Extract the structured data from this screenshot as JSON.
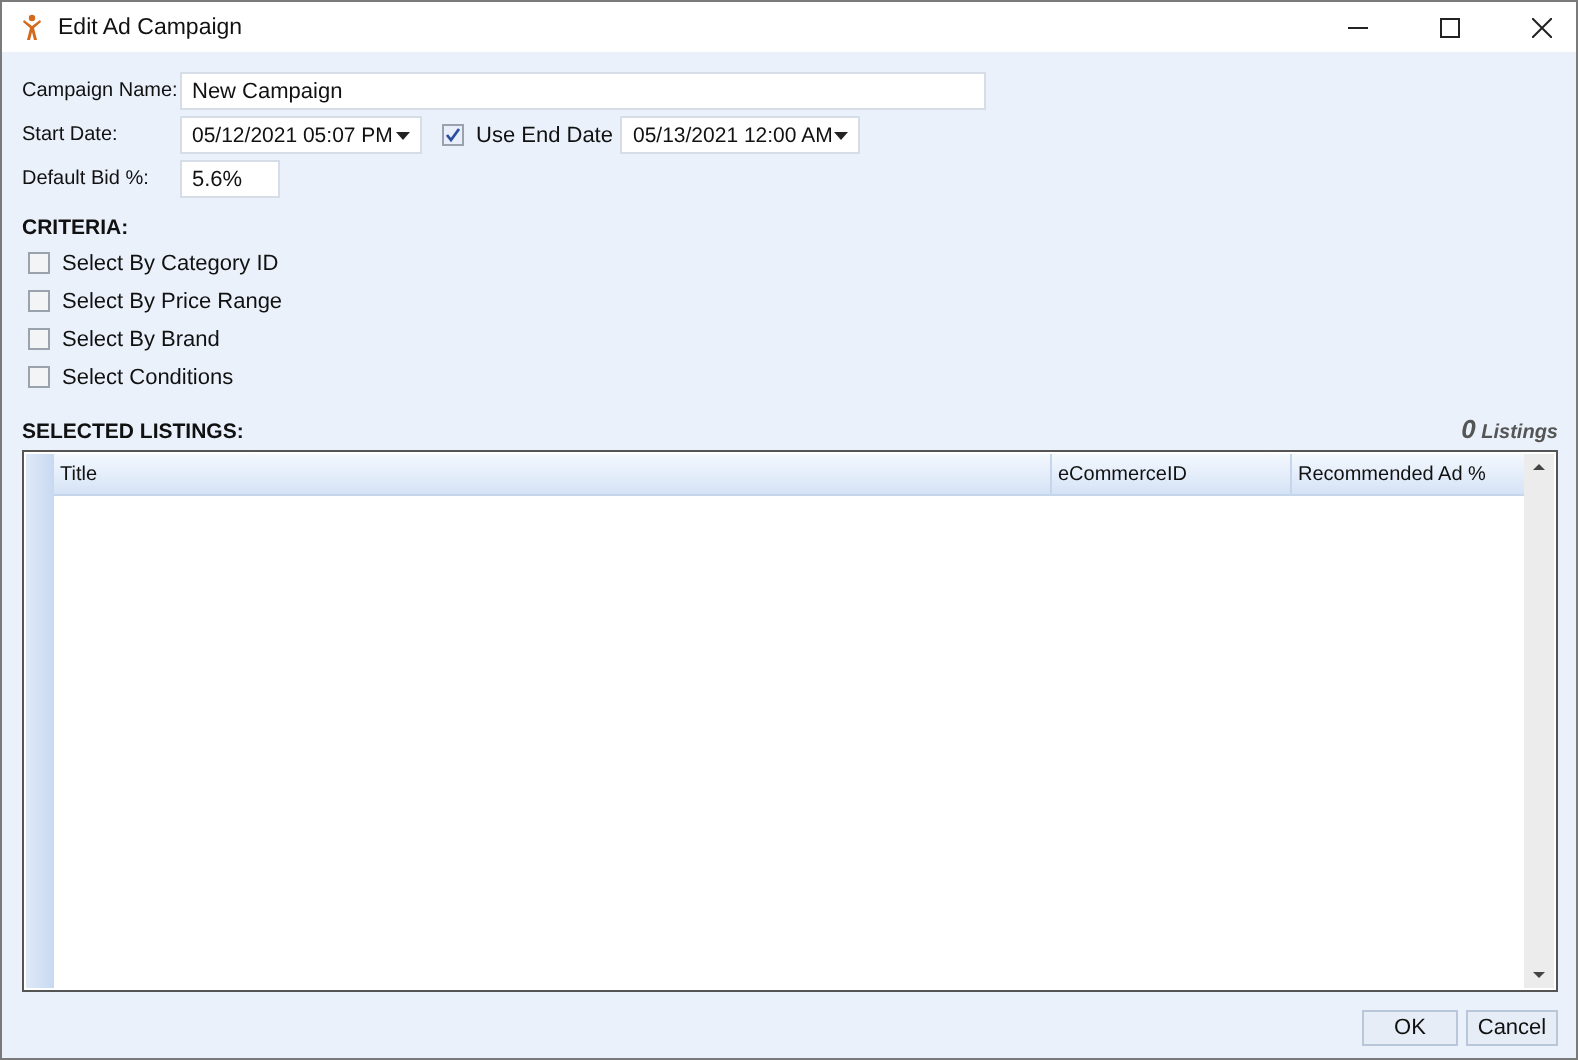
{
  "window": {
    "title": "Edit Ad Campaign"
  },
  "form": {
    "campaign_name": {
      "label": "Campaign Name:",
      "value": "New Campaign"
    },
    "start_date": {
      "label": "Start Date:",
      "value": "05/12/2021 05:07 PM"
    },
    "use_end_date": {
      "label": "Use End Date",
      "checked": true,
      "value": "05/13/2021 12:00 AM"
    },
    "default_bid": {
      "label": "Default Bid %:",
      "value": "5.6%"
    }
  },
  "criteria": {
    "title": "CRITERIA:",
    "items": [
      {
        "label": "Select By Category ID",
        "checked": false
      },
      {
        "label": "Select By Price Range",
        "checked": false
      },
      {
        "label": "Select By Brand",
        "checked": false
      },
      {
        "label": "Select Conditions",
        "checked": false
      }
    ]
  },
  "listings": {
    "title": "SELECTED LISTINGS:",
    "count": "0",
    "count_label": "Listings",
    "columns": [
      "Title",
      "eCommerceID",
      "Recommended Ad %"
    ]
  },
  "buttons": [
    "OK",
    "Cancel"
  ]
}
